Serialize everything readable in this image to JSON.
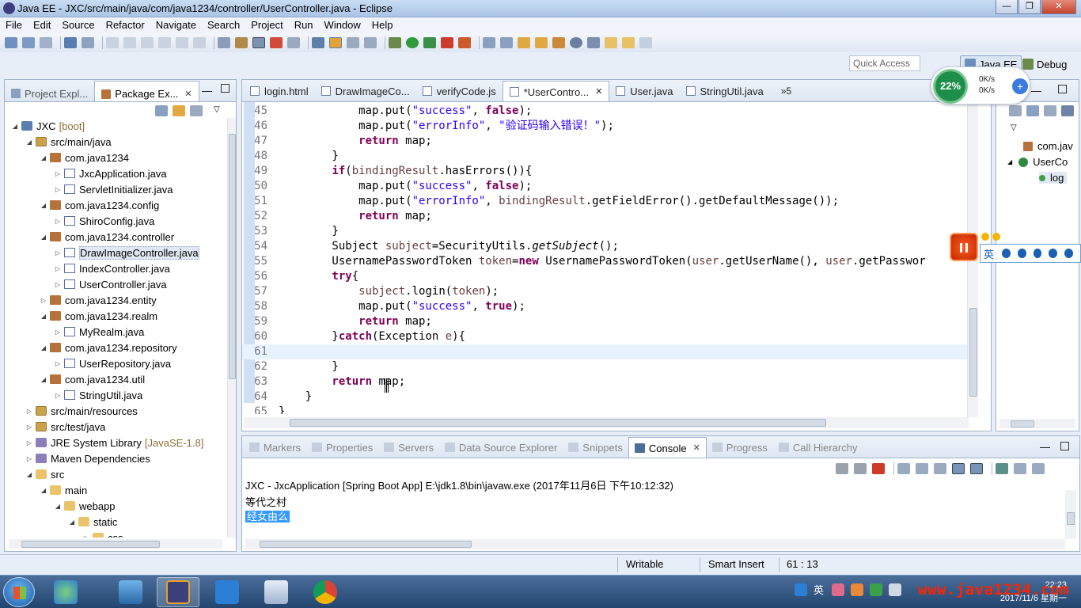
{
  "window": {
    "title": "Java EE - JXC/src/main/java/com/java1234/controller/UserController.java - Eclipse",
    "controls": [
      "—",
      "❐",
      "✕"
    ]
  },
  "menu": [
    "File",
    "Edit",
    "Source",
    "Refactor",
    "Navigate",
    "Search",
    "Project",
    "Run",
    "Window",
    "Help"
  ],
  "toolbar": {
    "quick_access_placeholder": "Quick Access",
    "perspectives": [
      "Java EE",
      "Debug"
    ]
  },
  "left_panel": {
    "tabs": [
      {
        "label": "Project Expl...",
        "active": false
      },
      {
        "label": "Package Ex...",
        "active": true
      }
    ],
    "tree": [
      {
        "label": "JXC",
        "decoration": "[boot]",
        "depth": 0,
        "expanded": true,
        "type": "project"
      },
      {
        "label": "src/main/java",
        "depth": 1,
        "expanded": true,
        "type": "src"
      },
      {
        "label": "com.java1234",
        "depth": 2,
        "expanded": true,
        "type": "pkg"
      },
      {
        "label": "JxcApplication.java",
        "depth": 3,
        "expanded": false,
        "type": "java"
      },
      {
        "label": "ServletInitializer.java",
        "depth": 3,
        "expanded": false,
        "type": "java"
      },
      {
        "label": "com.java1234.config",
        "depth": 2,
        "expanded": true,
        "type": "pkg"
      },
      {
        "label": "ShiroConfig.java",
        "depth": 3,
        "expanded": false,
        "type": "java"
      },
      {
        "label": "com.java1234.controller",
        "depth": 2,
        "expanded": true,
        "type": "pkg"
      },
      {
        "label": "DrawImageController.java",
        "depth": 3,
        "expanded": false,
        "type": "java",
        "selected": true
      },
      {
        "label": "IndexController.java",
        "depth": 3,
        "expanded": false,
        "type": "java"
      },
      {
        "label": "UserController.java",
        "depth": 3,
        "expanded": false,
        "type": "java"
      },
      {
        "label": "com.java1234.entity",
        "depth": 2,
        "expanded": false,
        "type": "pkg"
      },
      {
        "label": "com.java1234.realm",
        "depth": 2,
        "expanded": true,
        "type": "pkg"
      },
      {
        "label": "MyRealm.java",
        "depth": 3,
        "expanded": false,
        "type": "java"
      },
      {
        "label": "com.java1234.repository",
        "depth": 2,
        "expanded": true,
        "type": "pkg"
      },
      {
        "label": "UserRepository.java",
        "depth": 3,
        "expanded": false,
        "type": "java"
      },
      {
        "label": "com.java1234.util",
        "depth": 2,
        "expanded": true,
        "type": "pkg"
      },
      {
        "label": "StringUtil.java",
        "depth": 3,
        "expanded": false,
        "type": "java"
      },
      {
        "label": "src/main/resources",
        "depth": 1,
        "expanded": false,
        "type": "src"
      },
      {
        "label": "src/test/java",
        "depth": 1,
        "expanded": false,
        "type": "src"
      },
      {
        "label": "JRE System Library",
        "decoration": "[JavaSE-1.8]",
        "depth": 1,
        "expanded": false,
        "type": "lib"
      },
      {
        "label": "Maven Dependencies",
        "depth": 1,
        "expanded": false,
        "type": "lib"
      },
      {
        "label": "src",
        "depth": 1,
        "expanded": true,
        "type": "folder"
      },
      {
        "label": "main",
        "depth": 2,
        "expanded": true,
        "type": "folder"
      },
      {
        "label": "webapp",
        "depth": 3,
        "expanded": true,
        "type": "folder"
      },
      {
        "label": "static",
        "depth": 4,
        "expanded": true,
        "type": "folder"
      },
      {
        "label": "css",
        "depth": 5,
        "expanded": false,
        "type": "folder"
      }
    ]
  },
  "editor": {
    "tabs": [
      {
        "label": "login.html",
        "active": false
      },
      {
        "label": "DrawImageCo...",
        "active": false
      },
      {
        "label": "verifyCode.js",
        "active": false
      },
      {
        "label": "*UserContro...",
        "active": true
      },
      {
        "label": "User.java",
        "active": false
      },
      {
        "label": "StringUtil.java",
        "active": false
      }
    ],
    "more_tabs": "»5",
    "current_line": 61,
    "lines": [
      {
        "n": "45",
        "tokens": [
          [
            "",
            "            map.put("
          ],
          [
            "str",
            "\"success\""
          ],
          [
            "",
            ", "
          ],
          [
            "kw",
            "false"
          ],
          [
            "",
            ");"
          ]
        ]
      },
      {
        "n": "46",
        "tokens": [
          [
            "",
            "            map.put("
          ],
          [
            "str",
            "\"errorInfo\""
          ],
          [
            "",
            ", "
          ],
          [
            "str",
            "\"验证码输入错误！\""
          ],
          [
            "",
            ");"
          ]
        ]
      },
      {
        "n": "47",
        "tokens": [
          [
            "kw",
            "            return"
          ],
          [
            "",
            " map;"
          ]
        ]
      },
      {
        "n": "48",
        "tokens": [
          [
            "",
            "        }"
          ]
        ]
      },
      {
        "n": "49",
        "tokens": [
          [
            "kw",
            "        if"
          ],
          [
            "",
            "("
          ],
          [
            "var",
            "bindingResult"
          ],
          [
            "",
            ".hasErrors()){"
          ]
        ]
      },
      {
        "n": "50",
        "tokens": [
          [
            "",
            "            map.put("
          ],
          [
            "str",
            "\"success\""
          ],
          [
            "",
            ", "
          ],
          [
            "kw",
            "false"
          ],
          [
            "",
            ");"
          ]
        ]
      },
      {
        "n": "51",
        "tokens": [
          [
            "",
            "            map.put("
          ],
          [
            "str",
            "\"errorInfo\""
          ],
          [
            "",
            ", "
          ],
          [
            "var",
            "bindingResult"
          ],
          [
            "",
            ".getFieldError().getDefaultMessage());"
          ]
        ]
      },
      {
        "n": "52",
        "tokens": [
          [
            "kw",
            "            return"
          ],
          [
            "",
            " map;"
          ]
        ]
      },
      {
        "n": "53",
        "tokens": [
          [
            "",
            "        }"
          ]
        ]
      },
      {
        "n": "54",
        "tokens": [
          [
            "",
            "        Subject "
          ],
          [
            "var",
            "subject"
          ],
          [
            "",
            "=SecurityUtils."
          ],
          [
            "ital",
            "getSubject"
          ],
          [
            "",
            "();"
          ]
        ]
      },
      {
        "n": "55",
        "tokens": [
          [
            "",
            "        UsernamePasswordToken "
          ],
          [
            "var",
            "token"
          ],
          [
            "",
            "="
          ],
          [
            "kw",
            "new"
          ],
          [
            "",
            " UsernamePasswordToken("
          ],
          [
            "var",
            "user"
          ],
          [
            "",
            ".getUserName(), "
          ],
          [
            "var",
            "user"
          ],
          [
            "",
            ".getPasswor"
          ]
        ]
      },
      {
        "n": "56",
        "tokens": [
          [
            "kw",
            "        try"
          ],
          [
            "",
            "{"
          ]
        ]
      },
      {
        "n": "57",
        "tokens": [
          [
            "",
            "            "
          ],
          [
            "var",
            "subject"
          ],
          [
            "",
            ".login("
          ],
          [
            "var",
            "token"
          ],
          [
            "",
            ");"
          ]
        ]
      },
      {
        "n": "58",
        "tokens": [
          [
            "",
            "            map.put("
          ],
          [
            "str",
            "\"success\""
          ],
          [
            "",
            ", "
          ],
          [
            "kw",
            "true"
          ],
          [
            "",
            ");"
          ]
        ]
      },
      {
        "n": "59",
        "tokens": [
          [
            "kw",
            "            return"
          ],
          [
            "",
            " map;"
          ]
        ]
      },
      {
        "n": "60",
        "tokens": [
          [
            "",
            "        }"
          ],
          [
            "kw",
            "catch"
          ],
          [
            "",
            "(Exception "
          ],
          [
            "var",
            "e"
          ],
          [
            "",
            "){"
          ]
        ]
      },
      {
        "n": "61",
        "tokens": [
          [
            "",
            ""
          ]
        ]
      },
      {
        "n": "62",
        "tokens": [
          [
            "",
            "        }"
          ]
        ]
      },
      {
        "n": "63",
        "tokens": [
          [
            "kw",
            "        return"
          ],
          [
            "",
            " map;"
          ]
        ]
      },
      {
        "n": "64",
        "tokens": [
          [
            "",
            "    }"
          ]
        ]
      },
      {
        "n": "65",
        "tokens": [
          [
            "",
            "}"
          ]
        ]
      }
    ]
  },
  "outline": {
    "rows": [
      "com.jav",
      "UserCo",
      "log"
    ]
  },
  "console": {
    "tabs": [
      {
        "label": "Markers",
        "active": false
      },
      {
        "label": "Properties",
        "active": false
      },
      {
        "label": "Servers",
        "active": false
      },
      {
        "label": "Data Source Explorer",
        "active": false
      },
      {
        "label": "Snippets",
        "active": false
      },
      {
        "label": "Console",
        "active": true
      },
      {
        "label": "Progress",
        "active": false
      },
      {
        "label": "Call Hierarchy",
        "active": false
      }
    ],
    "header": "JXC - JxcApplication [Spring Boot App] E:\\jdk1.8\\bin\\javaw.exe (2017年11月6日 下午10:12:32)",
    "output": [
      "等代之村",
      "经女由么"
    ]
  },
  "status_bar": {
    "writable": "Writable",
    "insert_mode": "Smart Insert",
    "position": "61 : 13"
  },
  "floating": {
    "net_percent": "22%",
    "net_up": "0K/s",
    "net_down": "0K/s",
    "ime_label": "英"
  },
  "taskbar": {
    "ime": "英",
    "time": "22:23",
    "date": "2017/11/6 星期一",
    "watermark": "www.java1234.com"
  }
}
